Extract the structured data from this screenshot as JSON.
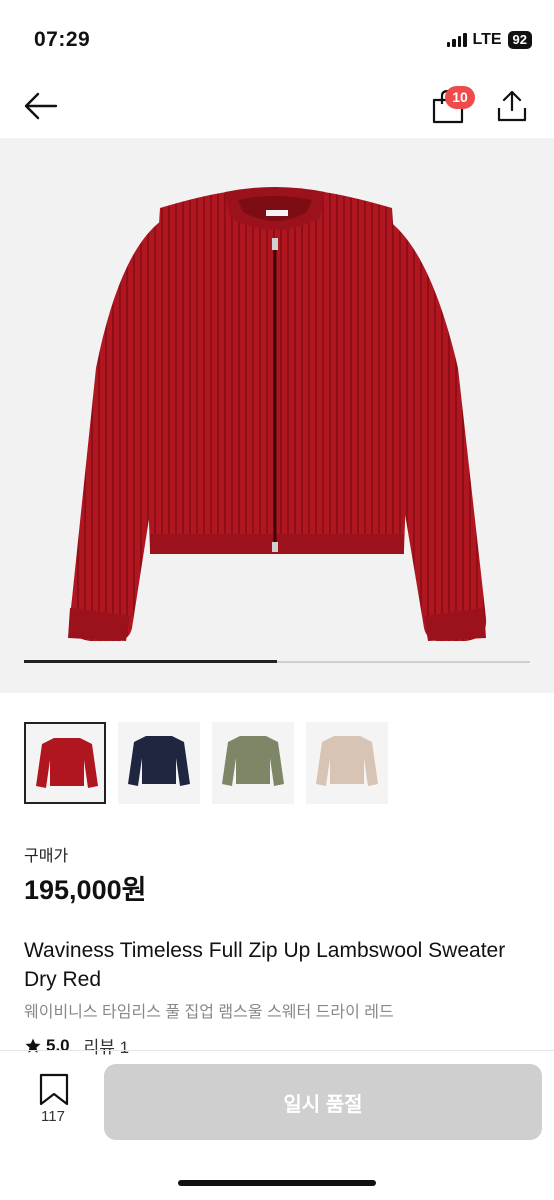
{
  "status_bar": {
    "time": "07:29",
    "network": "LTE",
    "battery": "92"
  },
  "nav": {
    "back_icon": "arrow-left-icon",
    "cart_icon": "shopping-bag-icon",
    "cart_badge": "10",
    "share_icon": "share-icon"
  },
  "gallery": {
    "product_color": "#b01620",
    "progress": 0.5,
    "thumbnails": [
      {
        "color": "#b01620",
        "selected": true
      },
      {
        "color": "#1f2640",
        "selected": false
      },
      {
        "color": "#7d8768",
        "selected": false
      },
      {
        "color": "#d8c4b4",
        "selected": false
      }
    ]
  },
  "price": {
    "label": "구매가",
    "value": "195,000원"
  },
  "product": {
    "title_en": "Waviness Timeless Full Zip Up Lambswool Sweater Dry Red",
    "title_ko": "웨이비니스 타임리스 풀 집업 램스울 스웨터 드라이 레드",
    "rating": "5.0",
    "review_text": "리뷰 1"
  },
  "bottom_bar": {
    "bookmark_icon": "bookmark-icon",
    "bookmark_count": "117",
    "button_label": "일시 품절",
    "button_color": "#cfcfcf"
  },
  "colors": {
    "badge": "#ef4b4b",
    "background": "#f2f2f2"
  }
}
